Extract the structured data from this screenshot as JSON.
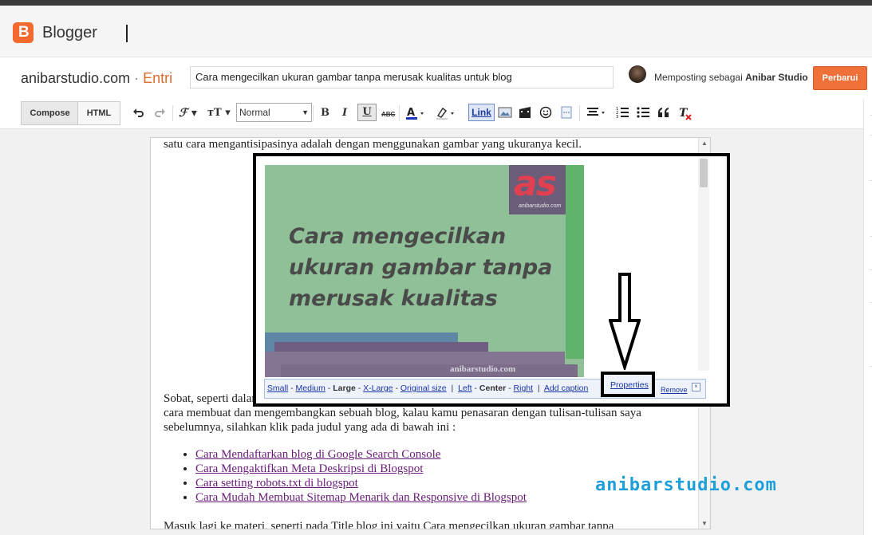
{
  "app": {
    "name": "Blogger"
  },
  "post_header": {
    "blog_name": "anibarstudio.com",
    "separator": "·",
    "mode": "Entri",
    "title_value": "Cara mengecilkan ukuran gambar tanpa merusak kualitas untuk blog",
    "posting_as_prefix": "Memposting sebagai",
    "posting_as_user": "Anibar Studio",
    "update_label": "Perbarui"
  },
  "toolbar": {
    "compose_label": "Compose",
    "html_label": "HTML",
    "format_value": "Normal",
    "bold": "B",
    "italic": "I",
    "underline": "U",
    "strike": "ABC",
    "link_label": "Link"
  },
  "editor": {
    "line1": "satu cara mengantisipasinya adalah dengan menggunakan gambar yang ukuranya kecil.",
    "para2": "Sobat, seperti dalam postingan-postingan sebelumnya, disini saya sedang menyusun materi bagaimana cara membuat dan mengembangkan sebuah blog, kalau kamu penasaran dengan tulisan-tulisan saya sebelumnya, silahkan klik pada judul yang ada di bawah ini :",
    "links": [
      "Cara Mendaftarkan blog di Google Search Console",
      "Cara Mengaktifkan Meta Deskripsi di Blogspot",
      "Cara setting robots.txt di blogspot",
      "Cara Mudah Membuat Sitemap Menarik dan Responsive di Blogspot"
    ],
    "para3": "Masuk lagi ke materi, seperti pada Title blog ini yaitu Cara mengecilkan ukuran gambar tanpa"
  },
  "image": {
    "headline_lines": [
      "Cara mengecilkan",
      "ukuran gambar tanpa",
      "merusak kualitas"
    ],
    "logo_text": "as",
    "logo_sub": "anibarstudio.com",
    "watermark": "anibarstudio.com"
  },
  "image_toolbar": {
    "small": "Small",
    "medium": "Medium",
    "large": "Large",
    "xlarge": "X-Large",
    "original": "Original size",
    "left": "Left",
    "center": "Center",
    "right": "Right",
    "add_caption": "Add caption",
    "properties": "Properties",
    "remove": "Remove",
    "close": "×"
  },
  "watermark_brand": "anibarstudio.com"
}
